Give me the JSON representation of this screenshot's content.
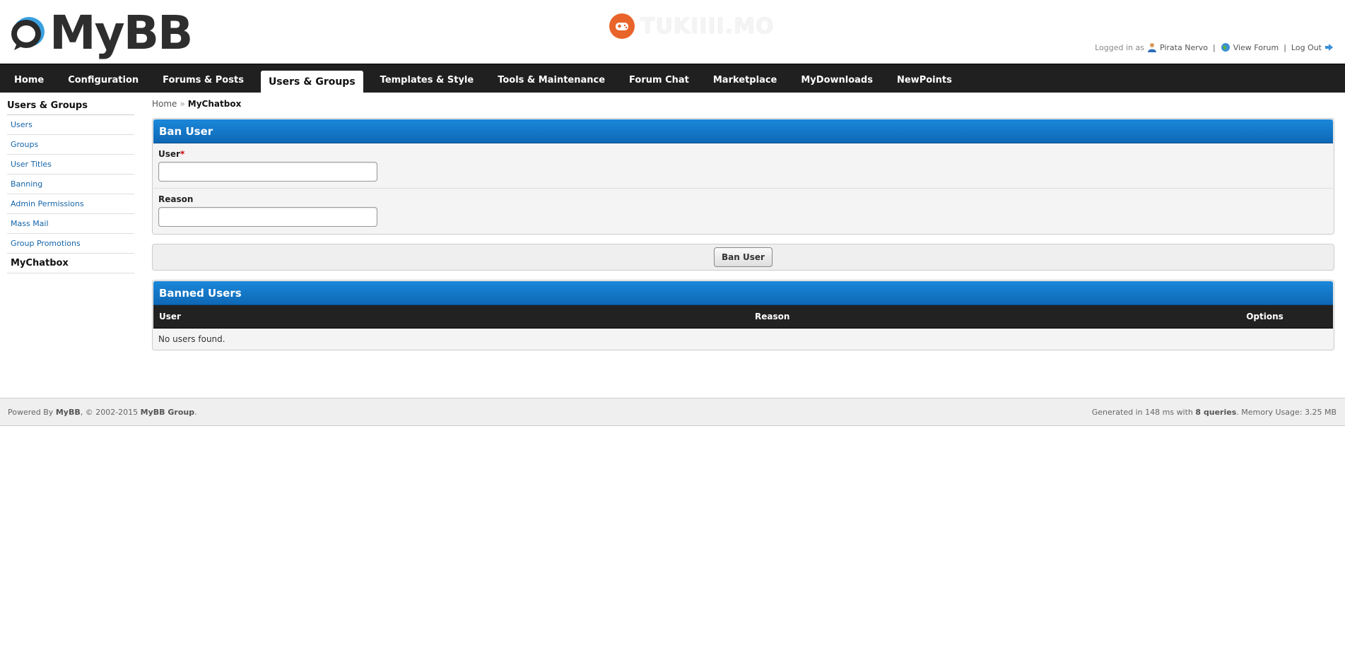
{
  "header": {
    "logo_text": "MyBB",
    "partner_text": "TUKIIII.MO",
    "user": {
      "logged_in_prefix": "Logged in as",
      "username": "Pirata Nervo",
      "view_forum": "View Forum",
      "log_out": "Log Out",
      "separator": "|"
    }
  },
  "nav": {
    "items": [
      {
        "label": "Home"
      },
      {
        "label": "Configuration"
      },
      {
        "label": "Forums & Posts"
      },
      {
        "label": "Users & Groups"
      },
      {
        "label": "Templates & Style"
      },
      {
        "label": "Tools & Maintenance"
      },
      {
        "label": "Forum Chat"
      },
      {
        "label": "Marketplace"
      },
      {
        "label": "MyDownloads"
      },
      {
        "label": "NewPoints"
      }
    ],
    "active": "Users & Groups"
  },
  "sidebar": {
    "title": "Users & Groups",
    "items": [
      {
        "label": "Users"
      },
      {
        "label": "Groups"
      },
      {
        "label": "User Titles"
      },
      {
        "label": "Banning"
      },
      {
        "label": "Admin Permissions"
      },
      {
        "label": "Mass Mail"
      },
      {
        "label": "Group Promotions"
      },
      {
        "label": "MyChatbox"
      }
    ]
  },
  "breadcrumb": {
    "home": "Home",
    "separator": "»",
    "current": "MyChatbox"
  },
  "ban_form": {
    "title": "Ban User",
    "user_label": "User",
    "required_mark": "*",
    "user_value": "",
    "reason_label": "Reason",
    "reason_value": "",
    "submit_label": "Ban User"
  },
  "banned_users": {
    "title": "Banned Users",
    "columns": [
      "User",
      "Reason",
      "Options"
    ],
    "empty_text": "No users found."
  },
  "footer": {
    "powered_by_prefix": "Powered By",
    "mybb": "MyBB",
    "copyright_mid": ", © 2002-2015",
    "group": "MyBB Group",
    "generated_prefix": "Generated in 148 ms with",
    "queries": "8 queries",
    "memory": ". Memory Usage: 3.25 MB"
  },
  "colors": {
    "nav_bg": "#202020",
    "panel_head": "#0e68b6",
    "link": "#1464a8",
    "partner_orange": "#e8642a"
  }
}
